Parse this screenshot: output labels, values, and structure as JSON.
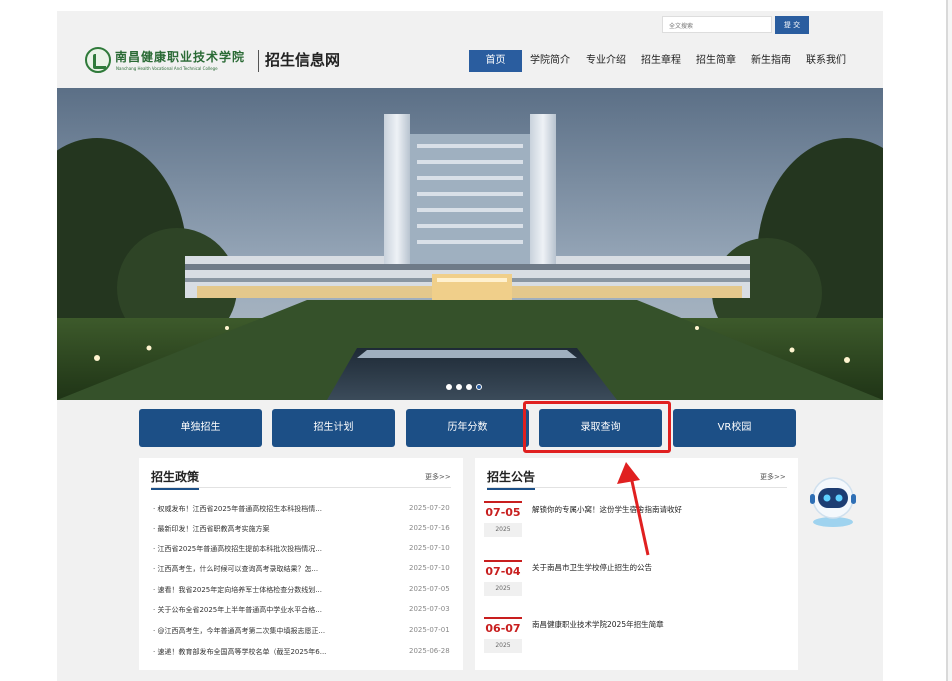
{
  "header": {
    "search_placeholder": "全文搜索",
    "search_button": "提 交",
    "logo_cn": "南昌健康职业技术学院",
    "logo_en": "Nanchang Health Vocational And Technical College",
    "site_name": "招生信息网"
  },
  "nav": [
    {
      "label": "首页",
      "active": true
    },
    {
      "label": "学院简介"
    },
    {
      "label": "专业介绍"
    },
    {
      "label": "招生章程"
    },
    {
      "label": "招生简章"
    },
    {
      "label": "新生指南"
    },
    {
      "label": "联系我们"
    }
  ],
  "banner": {
    "slide_count": 4,
    "active_slide": 4
  },
  "quick_links": [
    {
      "label": "单独招生"
    },
    {
      "label": "招生计划"
    },
    {
      "label": "历年分数"
    },
    {
      "label": "录取查询"
    },
    {
      "label": "VR校园"
    }
  ],
  "policy": {
    "title": "招生政策",
    "more": "更多>>",
    "items": [
      {
        "title": "· 权威发布！江西省2025年普通高校招生本科投档情...",
        "date": "2025-07-20"
      },
      {
        "title": "· 最新印发！江西省职教高考实施方案",
        "date": "2025-07-16"
      },
      {
        "title": "· 江西省2025年普通高校招生提前本科批次投档情况...",
        "date": "2025-07-10"
      },
      {
        "title": "· 江西高考生，什么时候可以查询高考录取结果？怎...",
        "date": "2025-07-10"
      },
      {
        "title": "· 速看！我省2025年定向培养军士体格检查分数线划...",
        "date": "2025-07-05"
      },
      {
        "title": "· 关于公布全省2025年上半年普通高中学业水平合格...",
        "date": "2025-07-03"
      },
      {
        "title": "· @江西高考生，今年普通高考第二次集中填报志愿正...",
        "date": "2025-07-01"
      },
      {
        "title": "· 速递！教育部发布全国高等学校名单（截至2025年6...",
        "date": "2025-06-28"
      }
    ]
  },
  "notice": {
    "title": "招生公告",
    "more": "更多>>",
    "items": [
      {
        "md": "07-05",
        "year": "2025",
        "title": "解锁你的专属小窝！这份学生宿舍指南请收好"
      },
      {
        "md": "07-04",
        "year": "2025",
        "title": "关于南昌市卫生学校停止招生的公告"
      },
      {
        "md": "06-07",
        "year": "2025",
        "title": "南昌健康职业技术学院2025年招生简章"
      }
    ]
  },
  "colors": {
    "primary": "#1c4f86",
    "nav_active": "#2a5d9f",
    "highlight": "#e02020",
    "date_red": "#c81e1e"
  }
}
